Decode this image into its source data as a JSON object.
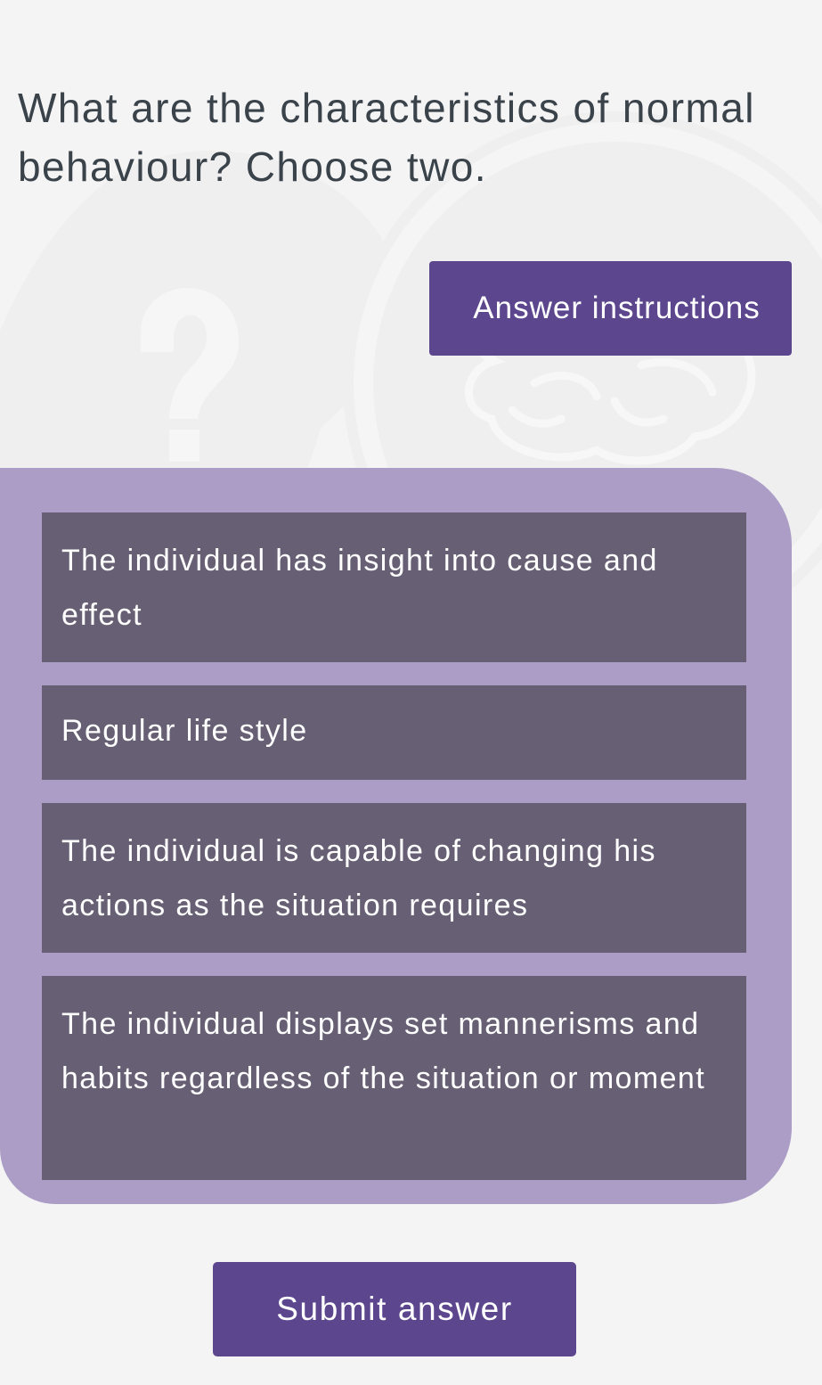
{
  "question": {
    "text": "What are the characteristics of normal behaviour? Choose two."
  },
  "answer_instructions": {
    "label": "Answer instructions"
  },
  "options": [
    {
      "text": "The individual has insight into cause and effect"
    },
    {
      "text": "Regular life style"
    },
    {
      "text": "The individual is capable of changing his actions as the situation requires"
    },
    {
      "text": "The individual displays set mannerisms and habits regardless of the situation or moment"
    }
  ],
  "submit": {
    "label": "Submit answer"
  },
  "background": {
    "icons": [
      "question-mark-icon",
      "brain-icon"
    ]
  },
  "colors": {
    "page_bg": "#f4f4f5",
    "primary": "#5c468e",
    "panel": "#a89ac3",
    "option_bg": "#676074",
    "question_text": "#3a424a"
  }
}
